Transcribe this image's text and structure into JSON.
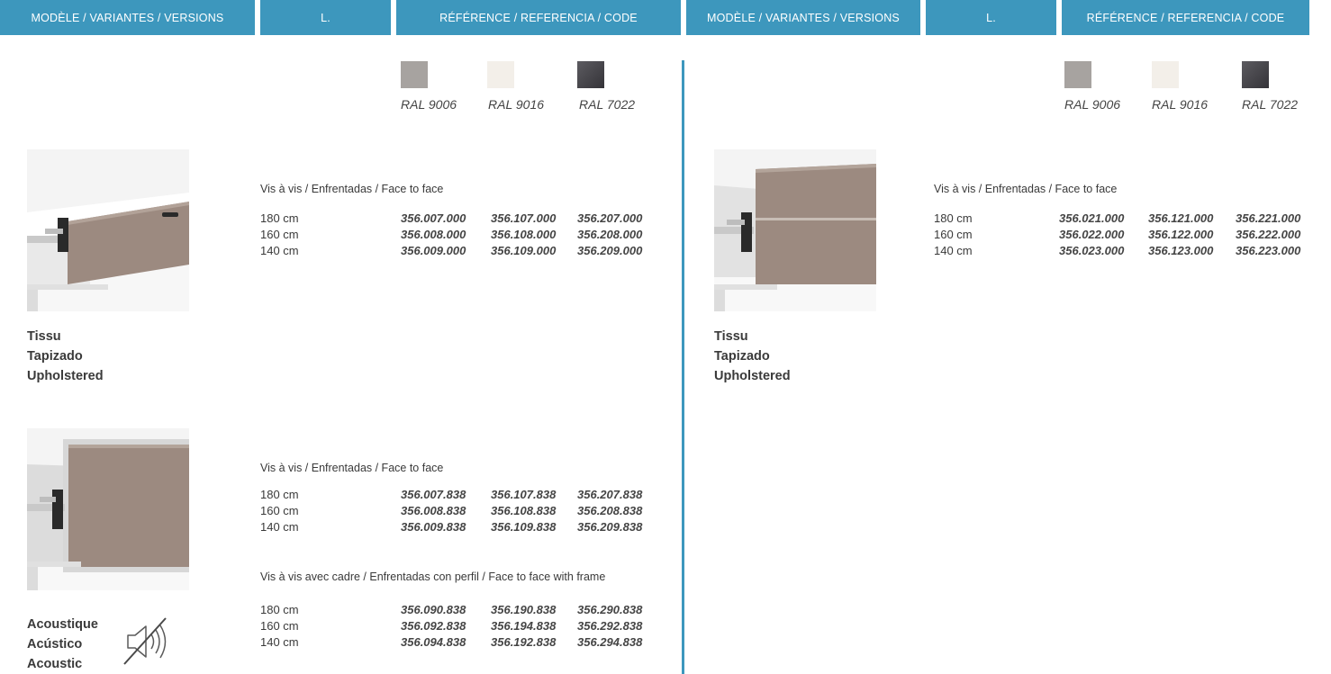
{
  "headers": [
    "MODÈLE / VARIANTES / VERSIONS",
    "L.",
    "RÉFÉRENCE / REFERENCIA / CODE",
    "MODÈLE / VARIANTES / VERSIONS",
    "L.",
    "RÉFÉRENCE / REFERENCIA / CODE"
  ],
  "swatches": [
    {
      "label": "RAL 9006",
      "color": "#a7a3a0"
    },
    {
      "label": "RAL 9016",
      "color": "#f3efe9"
    },
    {
      "label": "RAL 7022",
      "color": "#47464b"
    }
  ],
  "left": {
    "tapizado": {
      "names": [
        "Tissu",
        "Tapizado",
        "Upholstered"
      ],
      "subtitle": "Vis à vis / Enfrentadas / Face to face",
      "rows": [
        {
          "len": "180 cm",
          "codes": [
            "356.007.000",
            "356.107.000",
            "356.207.000"
          ]
        },
        {
          "len": "160 cm",
          "codes": [
            "356.008.000",
            "356.108.000",
            "356.208.000"
          ]
        },
        {
          "len": "140 cm",
          "codes": [
            "356.009.000",
            "356.109.000",
            "356.209.000"
          ]
        }
      ]
    },
    "acoustic": {
      "names": [
        "Acoustique",
        "Acústico",
        "Acoustic"
      ],
      "subtitle1": "Vis à vis / Enfrentadas / Face to face",
      "rows1": [
        {
          "len": "180 cm",
          "codes": [
            "356.007.838",
            "356.107.838",
            "356.207.838"
          ]
        },
        {
          "len": "160 cm",
          "codes": [
            "356.008.838",
            "356.108.838",
            "356.208.838"
          ]
        },
        {
          "len": "140 cm",
          "codes": [
            "356.009.838",
            "356.109.838",
            "356.209.838"
          ]
        }
      ],
      "subtitle2": "Vis à vis avec cadre / Enfrentadas con perfil / Face to face with frame",
      "rows2": [
        {
          "len": "180 cm",
          "codes": [
            "356.090.838",
            "356.190.838",
            "356.290.838"
          ]
        },
        {
          "len": "160 cm",
          "codes": [
            "356.092.838",
            "356.194.838",
            "356.292.838"
          ]
        },
        {
          "len": "140 cm",
          "codes": [
            "356.094.838",
            "356.192.838",
            "356.294.838"
          ]
        }
      ]
    }
  },
  "right": {
    "tapizado": {
      "names": [
        "Tissu",
        "Tapizado",
        "Upholstered"
      ],
      "subtitle": "Vis à vis / Enfrentadas / Face to face",
      "rows": [
        {
          "len": "180 cm",
          "codes": [
            "356.021.000",
            "356.121.000",
            "356.221.000"
          ]
        },
        {
          "len": "160 cm",
          "codes": [
            "356.022.000",
            "356.122.000",
            "356.222.000"
          ]
        },
        {
          "len": "140 cm",
          "codes": [
            "356.023.000",
            "356.123.000",
            "356.223.000"
          ]
        }
      ]
    }
  },
  "colors": {
    "accent": "#3d97bd",
    "fabric": "#9c8a80"
  },
  "icons": [
    "muted-speaker-icon"
  ]
}
